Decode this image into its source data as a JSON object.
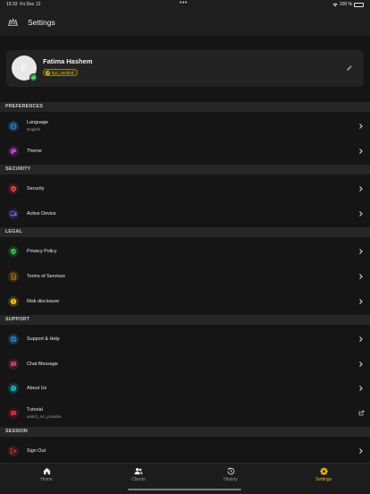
{
  "status_bar": {
    "time": "19:33",
    "date": "Fri Dec 12",
    "battery": "100 %",
    "center_dots": "•••"
  },
  "app_bar": {
    "title": "Settings"
  },
  "profile": {
    "initial": "F",
    "name": "Fatima Hashem",
    "badge": "kyc_verified"
  },
  "sections": {
    "preferences": "PREFERENCES",
    "security": "SECURITY",
    "legal": "LEGAL",
    "support": "SUPPORT",
    "session": "SESSION"
  },
  "items": {
    "language": {
      "label": "Language",
      "value": "English"
    },
    "theme": {
      "label": "Theme"
    },
    "security": {
      "label": "Security"
    },
    "active_device": {
      "label": "Active Device"
    },
    "privacy_policy": {
      "label": "Privacy Policy"
    },
    "terms": {
      "label": "Terms of Services"
    },
    "risk": {
      "label": "Risk disclosure"
    },
    "support_help": {
      "label": "Support & Help"
    },
    "chat_message": {
      "label": "Chat Message"
    },
    "about_us": {
      "label": "About Us"
    },
    "tutorial": {
      "label": "Tutorial",
      "value": "watch_on_youtube"
    },
    "sign_out": {
      "label": "Sign Out"
    }
  },
  "tabs": [
    {
      "label": "Home",
      "icon": "home-icon"
    },
    {
      "label": "Clients",
      "icon": "clients-icon"
    },
    {
      "label": "History",
      "icon": "history-icon"
    },
    {
      "label": "Settings",
      "icon": "gear-icon",
      "active": true
    }
  ],
  "colors": {
    "accent": "#e3b51f",
    "verified": "#27a844",
    "background": "#151515"
  }
}
